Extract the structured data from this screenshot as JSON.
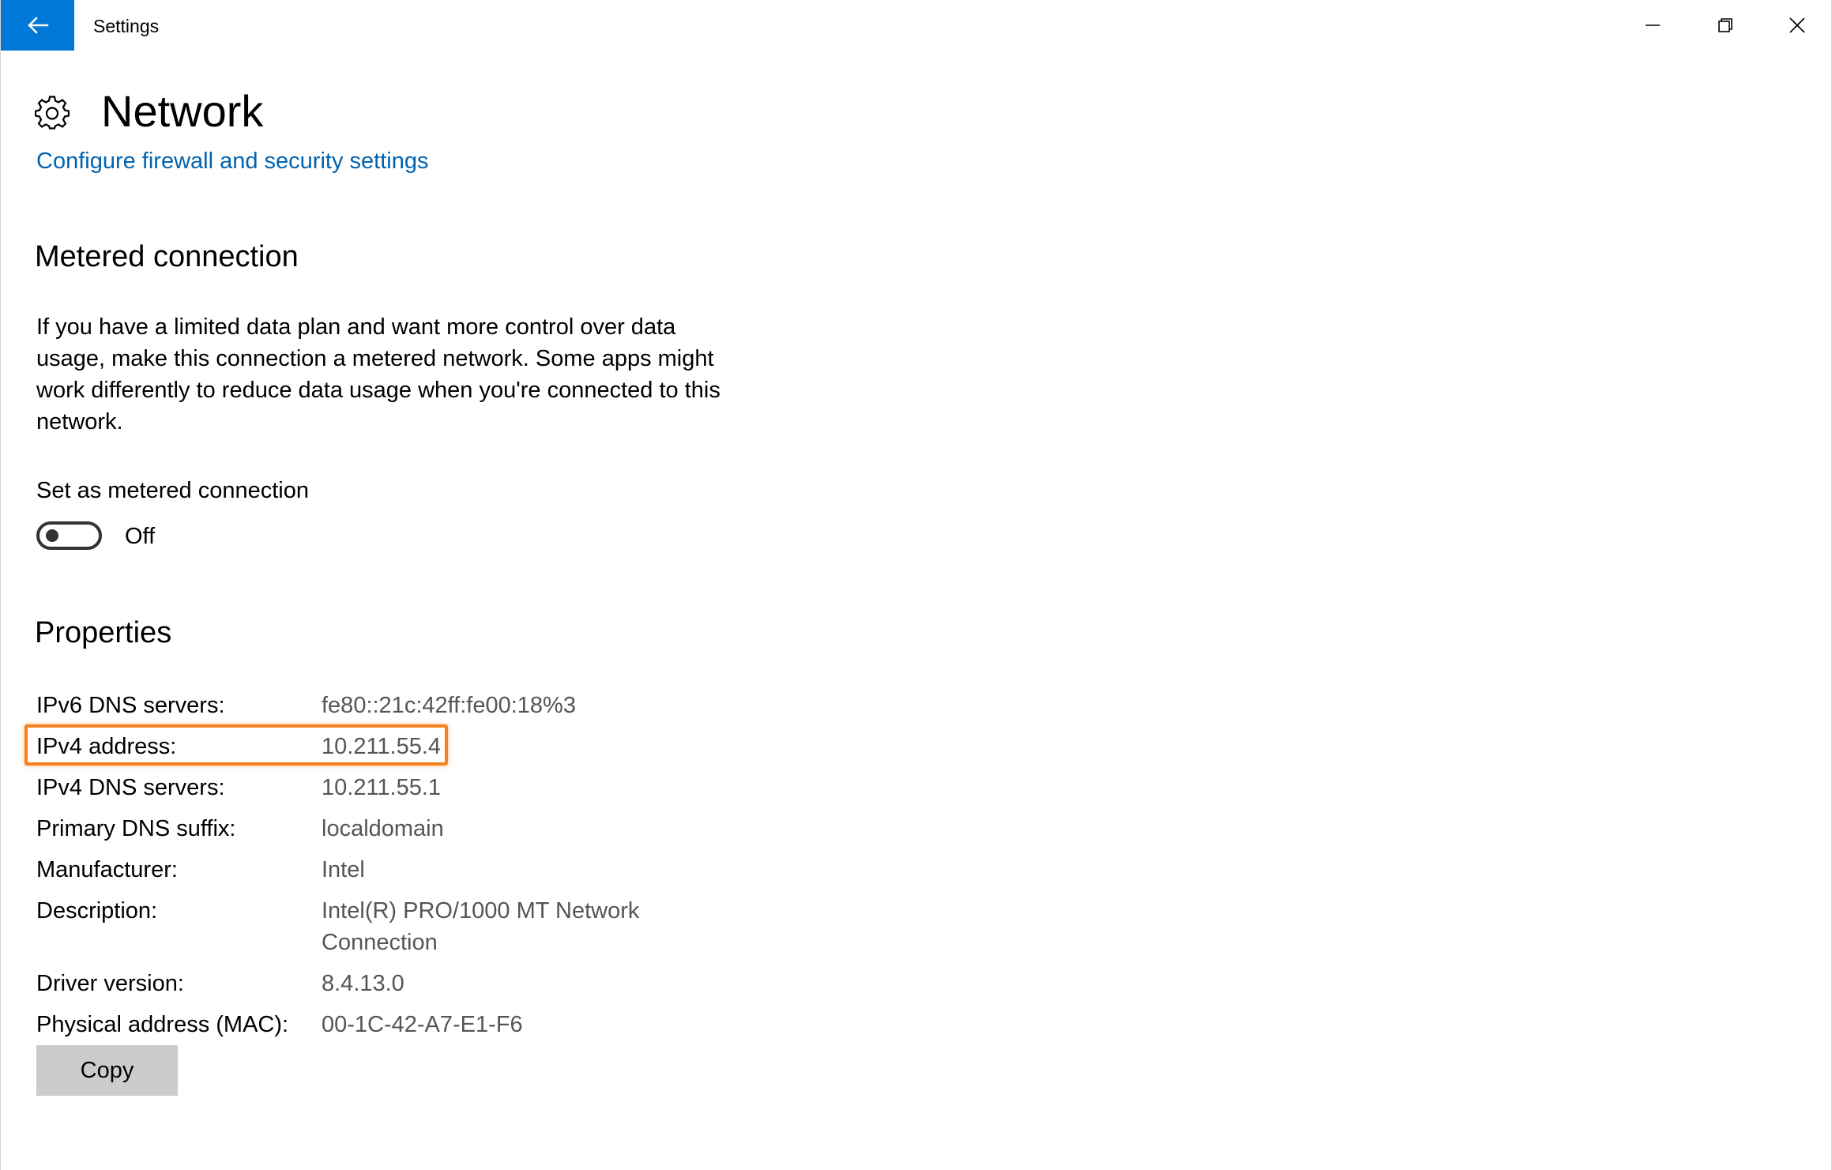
{
  "window": {
    "title": "Settings",
    "back_icon": "arrow-left-icon",
    "controls": [
      "minimize-icon",
      "maximize-icon",
      "close-icon"
    ],
    "accent_color": "#0078d7"
  },
  "header": {
    "icon": "gear-icon",
    "title": "Network",
    "link": "Configure firewall and security settings",
    "link_color": "#0063b1"
  },
  "metered": {
    "title": "Metered connection",
    "description": "If you have a limited data plan and want more control over data usage, make this connection a metered network. Some apps might work differently to reduce data usage when you're connected to this network.",
    "toggle_label": "Set as metered connection",
    "toggle_state": "Off",
    "toggle_on": false
  },
  "properties": {
    "title": "Properties",
    "rows": [
      {
        "label": "IPv6 DNS servers:",
        "value": "fe80::21c:42ff:fe00:18%3"
      },
      {
        "label": "IPv4 address:",
        "value": "10.211.55.4"
      },
      {
        "label": "IPv4 DNS servers:",
        "value": "10.211.55.1"
      },
      {
        "label": "Primary DNS suffix:",
        "value": "localdomain"
      },
      {
        "label": "Manufacturer:",
        "value": "Intel"
      },
      {
        "label": "Description:",
        "value": "Intel(R) PRO/1000 MT Network Connection"
      },
      {
        "label": "Driver version:",
        "value": "8.4.13.0"
      },
      {
        "label": "Physical address (MAC):",
        "value": "00-1C-42-A7-E1-F6"
      }
    ],
    "highlight_color": "#f7811e",
    "copy_label": "Copy"
  }
}
